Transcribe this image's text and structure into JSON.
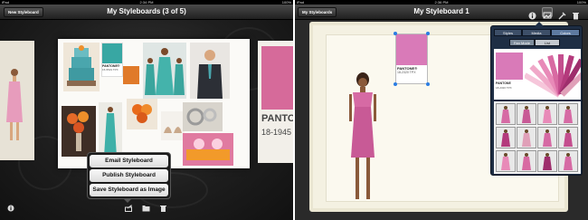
{
  "left": {
    "status": {
      "carrier": "iPad",
      "time": "2:34 PM",
      "battery": "100%"
    },
    "nav": {
      "back_label": "New Styleboard",
      "title": "My Styleboards (3 of 5)"
    },
    "card": {
      "pantone_brand": "PANTONE®",
      "pantone_code": "18-1945"
    },
    "collage": {
      "pantone_brand": "PANTONE®",
      "pantone_code": "15-5519 TPX"
    },
    "popover": {
      "email_label": "Email Styleboard",
      "publish_label": "Publish Styleboard",
      "save_label": "Save Styleboard as Image"
    }
  },
  "right": {
    "status": {
      "carrier": "iPad",
      "time": "2:36 PM",
      "battery": "100%"
    },
    "nav": {
      "back_label": "My Styleboards",
      "title": "My Styleboard 1"
    },
    "swatch": {
      "pantone_brand": "PANTONE®",
      "pantone_code": "18-2320 TPX"
    },
    "panel": {
      "tabs": [
        "Styles",
        "Media",
        "Colors"
      ],
      "subtabs": [
        "Fan Mode",
        "List"
      ],
      "active_tab": "Colors",
      "active_subtab": "Fan Mode",
      "preview": {
        "pantone_brand": "PANTONE",
        "pantone_code": "18-2320 TPX"
      }
    }
  },
  "colors": {
    "accent_pink": "#d97ab8",
    "teal": "#38a7a3",
    "orange": "#e07a2a"
  }
}
